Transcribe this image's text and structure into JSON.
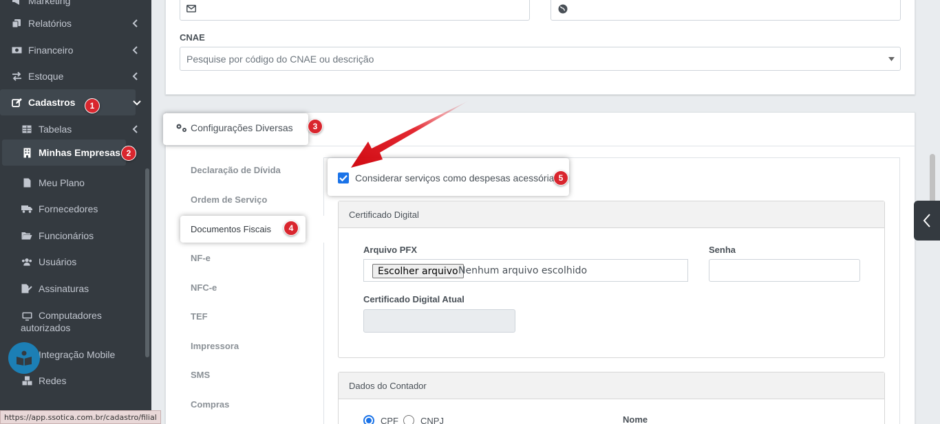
{
  "sidebar": {
    "items": [
      {
        "label": "Marketing",
        "icon": "bullhorn-icon"
      },
      {
        "label": "Relatórios",
        "icon": "copy-icon"
      },
      {
        "label": "Financeiro",
        "icon": "money-icon"
      },
      {
        "label": "Estoque",
        "icon": "exchange-icon"
      },
      {
        "label": "Cadastros",
        "icon": "edit-icon"
      },
      {
        "label": "Tabelas",
        "icon": "table-icon"
      },
      {
        "label": "Minhas Empresas",
        "icon": "building-icon"
      },
      {
        "label": "Meu Plano",
        "icon": "file-icon"
      },
      {
        "label": "Fornecedores",
        "icon": "truck-icon"
      },
      {
        "label": "Funcionários",
        "icon": "folder-open-icon"
      },
      {
        "label": "Usuários",
        "icon": "users-icon"
      },
      {
        "label": "Assinaturas",
        "icon": "file-signature-icon"
      },
      {
        "label": "Computadores autorizados",
        "label_line1": "Computadores",
        "label_line2": "autorizados",
        "icon": "desktop-icon"
      },
      {
        "label": "Integração Mobile",
        "icon": "mobile-icon"
      },
      {
        "label": "Redes",
        "icon": "cubes-icon"
      }
    ]
  },
  "badges": [
    "1",
    "2",
    "3",
    "4",
    "5"
  ],
  "status_url": "https://app.ssotica.com.br/cadastro/filial",
  "form": {
    "cnae_label": "CNAE",
    "cnae_placeholder": "Pesquise por código do CNAE ou descrição"
  },
  "config": {
    "title": "Configurações Diversas",
    "tabs": [
      "Declaração de Dívida",
      "Ordem de Serviço",
      "Documentos Fiscais",
      "NF-e",
      "NFC-e",
      "TEF",
      "Impressora",
      "SMS",
      "Compras"
    ],
    "active_tab": "Documentos Fiscais",
    "checkbox_label": "Considerar serviços como despesas acessórias",
    "checkbox_checked": true
  },
  "certificado": {
    "title": "Certificado Digital",
    "arquivo_label": "Arquivo PFX",
    "file_button": "Escolher arquivo",
    "file_status": "Nenhum arquivo escolhido",
    "senha_label": "Senha",
    "atual_label": "Certificado Digital Atual"
  },
  "contador": {
    "title": "Dados do Contador",
    "radio_cpf": "CPF",
    "radio_cnpj": "CNPJ",
    "nome_label": "Nome"
  },
  "colors": {
    "sidebar_bg": "#343a40",
    "badge_red": "#d9262e",
    "arrow_red": "#e0111b",
    "checkbox_blue": "#1a73e8"
  }
}
